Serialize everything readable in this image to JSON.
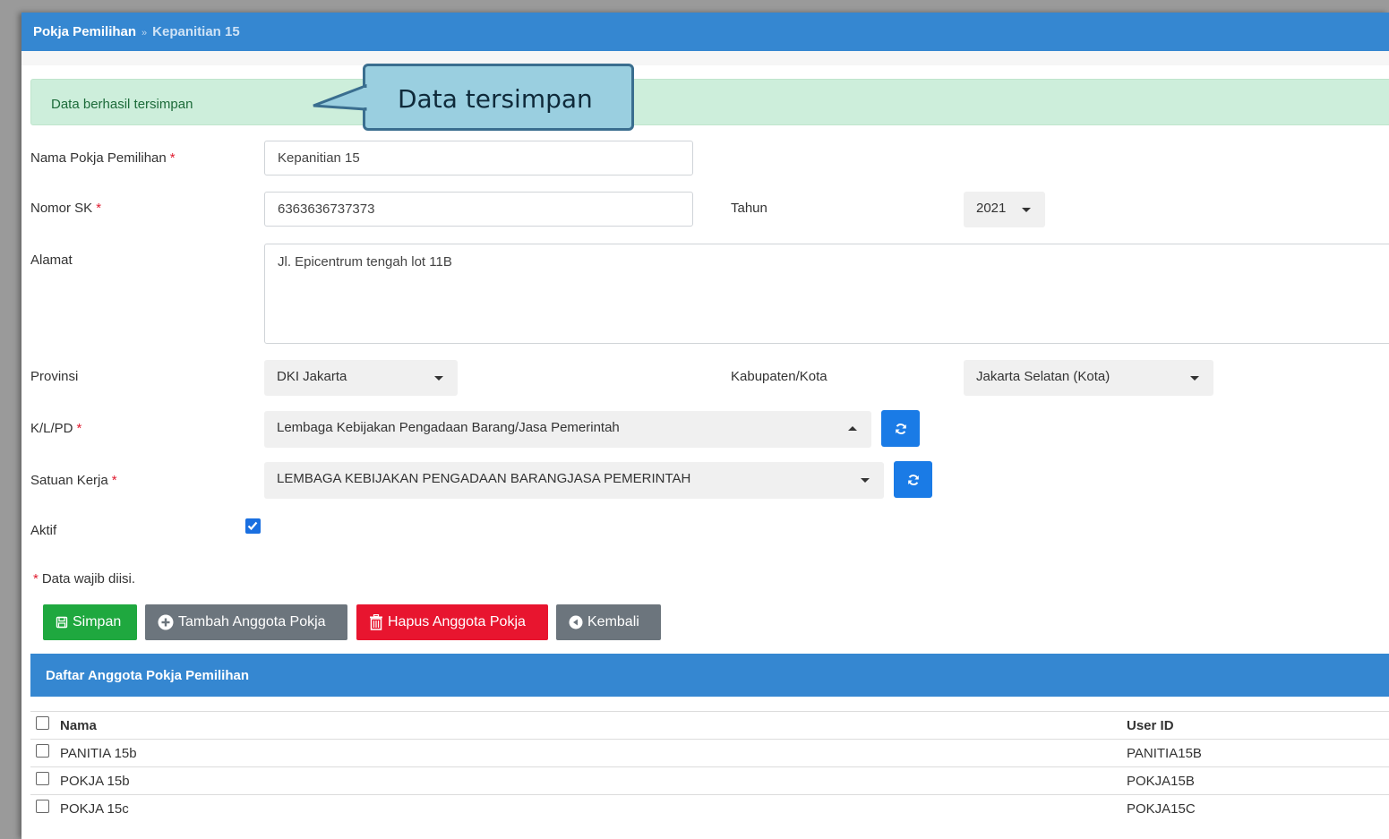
{
  "breadcrumb": {
    "parent": "Pokja Pemilihan",
    "separator": "»",
    "current": "Kepanitian 15"
  },
  "alert": {
    "message": "Data berhasil tersimpan"
  },
  "callout": {
    "text": "Data tersimpan"
  },
  "form": {
    "nama": {
      "label": "Nama Pokja Pemilihan",
      "value": "Kepanitian 15"
    },
    "nomor_sk": {
      "label": "Nomor SK",
      "value": "6363636737373"
    },
    "tahun": {
      "label": "Tahun",
      "value": "2021"
    },
    "alamat": {
      "label": "Alamat",
      "value": "Jl. Epicentrum tengah lot 11B"
    },
    "provinsi": {
      "label": "Provinsi",
      "value": "DKI Jakarta"
    },
    "kabupaten": {
      "label": "Kabupaten/Kota",
      "value": "Jakarta Selatan (Kota)"
    },
    "klpd": {
      "label": "K/L/PD",
      "value": "Lembaga Kebijakan Pengadaan Barang/Jasa Pemerintah"
    },
    "satker": {
      "label": "Satuan Kerja",
      "value": "LEMBAGA KEBIJAKAN PENGADAAN BARANGJASA PEMERINTAH"
    },
    "aktif": {
      "label": "Aktif",
      "checked": true
    },
    "required_marker": "*",
    "required_note": "Data wajib diisi."
  },
  "buttons": {
    "simpan": "Simpan",
    "tambah": "Tambah Anggota Pokja",
    "hapus": "Hapus Anggota Pokja",
    "kembali": "Kembali"
  },
  "panel": {
    "title": "Daftar Anggota Pokja Pemilihan",
    "columns": [
      "Nama",
      "User ID"
    ],
    "rows": [
      {
        "nama": "PANITIA 15b",
        "user_id": "PANITIA15B"
      },
      {
        "nama": "POKJA 15b",
        "user_id": "POKJA15B"
      },
      {
        "nama": "POKJA 15c",
        "user_id": "POKJA15C"
      }
    ]
  },
  "colors": {
    "primary": "#3587d1",
    "success": "#1fa83f",
    "danger": "#e8152f",
    "secondary": "#6c757d",
    "alert_bg": "#cdeedb",
    "callout_bg": "#9acfe0"
  },
  "icons": {
    "simpan": "save-icon",
    "tambah": "plus-circle-icon",
    "hapus": "trash-icon",
    "kembali": "back-circle-icon",
    "refresh": "refresh-icon",
    "dropdown": "caret-down-icon"
  }
}
